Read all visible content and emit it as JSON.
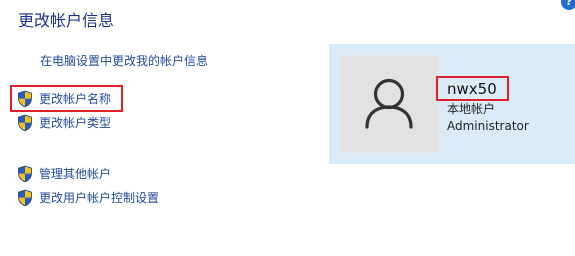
{
  "header": {
    "title": "更改帐户信息"
  },
  "links": {
    "pc_settings": "在电脑设置中更改我的帐户信息"
  },
  "tasks": [
    {
      "label": "更改帐户名称",
      "icon": "uac-shield-icon"
    },
    {
      "label": "更改帐户类型",
      "icon": "uac-shield-icon"
    },
    {
      "label": "管理其他帐户",
      "icon": "uac-shield-icon"
    },
    {
      "label": "更改用户帐户控制设置",
      "icon": "uac-shield-icon"
    }
  ],
  "account": {
    "name": "nwx50",
    "type": "本地帐户",
    "role": "Administrator",
    "avatar_icon": "user-silhouette-icon"
  },
  "help": {
    "icon": "help-icon",
    "label": "?"
  },
  "colors": {
    "title": "#1e3287",
    "link": "#1f4a9b",
    "card_background": "#dbeaf7",
    "avatar_background": "#e2e2e2",
    "highlight_border": "#e0202a"
  }
}
